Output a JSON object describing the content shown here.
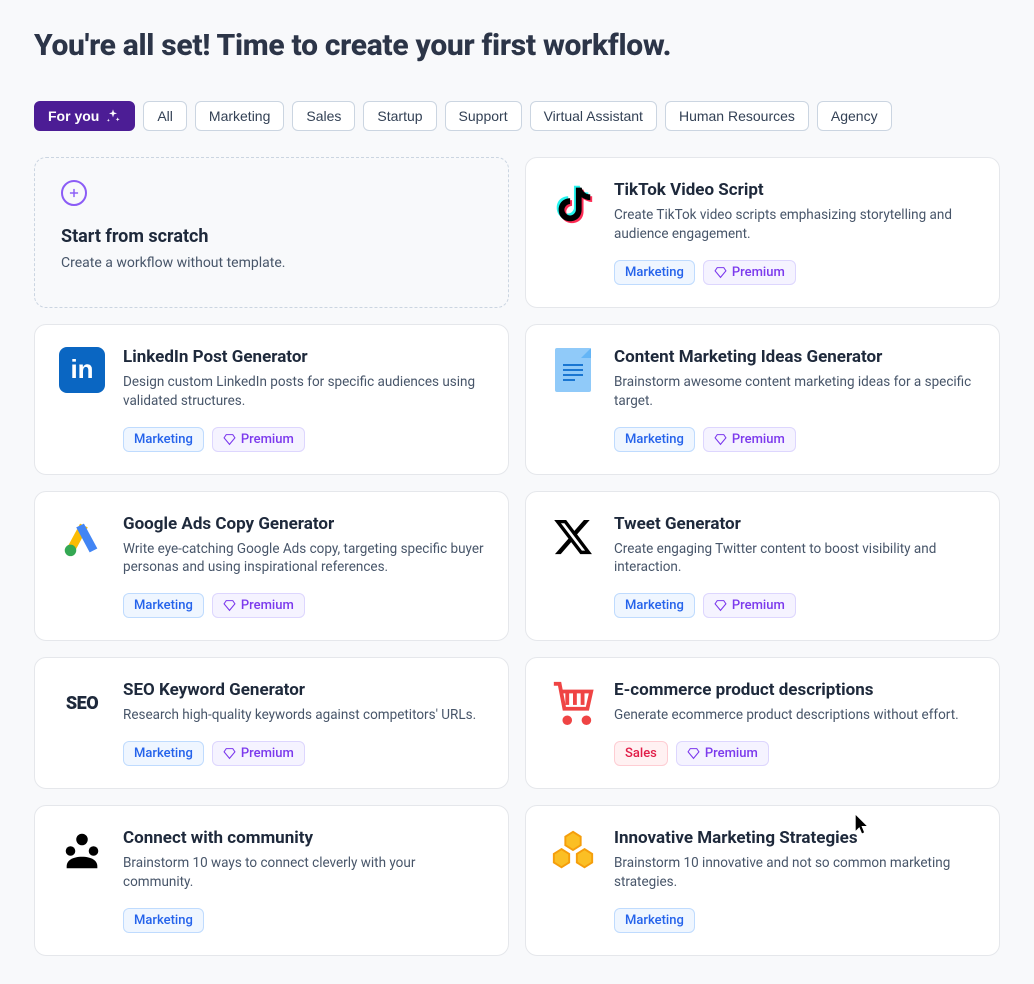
{
  "header": {
    "title": "You're all set! Time to create your first workflow."
  },
  "tabs": [
    {
      "label": "For you",
      "active": true,
      "hasIcon": true
    },
    {
      "label": "All",
      "active": false
    },
    {
      "label": "Marketing",
      "active": false
    },
    {
      "label": "Sales",
      "active": false
    },
    {
      "label": "Startup",
      "active": false
    },
    {
      "label": "Support",
      "active": false
    },
    {
      "label": "Virtual Assistant",
      "active": false
    },
    {
      "label": "Human Resources",
      "active": false
    },
    {
      "label": "Agency",
      "active": false
    }
  ],
  "scratch": {
    "title": "Start from scratch",
    "desc": "Create a workflow without template."
  },
  "badges": {
    "marketing": "Marketing",
    "sales": "Sales",
    "premium": "Premium"
  },
  "cards": [
    {
      "icon": "tiktok",
      "title": "TikTok Video Script",
      "desc": "Create TikTok video scripts emphasizing storytelling and audience engagement.",
      "tags": [
        "marketing"
      ],
      "premium": true
    },
    {
      "icon": "linkedin",
      "title": "LinkedIn Post Generator",
      "desc": "Design custom LinkedIn posts for specific audiences using validated structures.",
      "tags": [
        "marketing"
      ],
      "premium": true
    },
    {
      "icon": "document",
      "title": "Content Marketing Ideas Generator",
      "desc": "Brainstorm awesome content marketing ideas for a specific target.",
      "tags": [
        "marketing"
      ],
      "premium": true
    },
    {
      "icon": "google-ads",
      "title": "Google Ads Copy Generator",
      "desc": "Write eye-catching Google Ads copy, targeting specific buyer personas and using inspirational references.",
      "tags": [
        "marketing"
      ],
      "premium": true
    },
    {
      "icon": "x-twitter",
      "title": "Tweet Generator",
      "desc": "Create engaging Twitter content to boost visibility and interaction.",
      "tags": [
        "marketing"
      ],
      "premium": true
    },
    {
      "icon": "seo",
      "title": "SEO Keyword Generator",
      "desc": "Research high-quality keywords against competitors' URLs.",
      "tags": [
        "marketing"
      ],
      "premium": true
    },
    {
      "icon": "cart",
      "title": "E-commerce product descriptions",
      "desc": "Generate ecommerce product descriptions without effort.",
      "tags": [
        "sales"
      ],
      "premium": true
    },
    {
      "icon": "community",
      "title": "Connect with community",
      "desc": "Brainstorm 10 ways to connect cleverly with your community.",
      "tags": [
        "marketing"
      ],
      "premium": false
    },
    {
      "icon": "boxes",
      "title": "Innovative Marketing Strategies",
      "desc": "Brainstorm 10 innovative and not so common marketing strategies.",
      "tags": [
        "marketing"
      ],
      "premium": false
    }
  ]
}
